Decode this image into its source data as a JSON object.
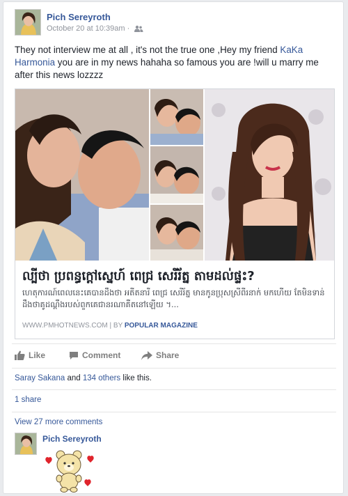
{
  "post": {
    "author": "Pich Sereyroth",
    "timestamp": "October 20 at 10:39am",
    "privacy_icon": "friends-icon",
    "text_before": "They not interview me at all , it's not the true one ,Hey my friend ",
    "mention": "KaKa Harmonia",
    "text_after": " you are in my news hahaha so famous you are !will u marry me after this news lozzzz"
  },
  "link_preview": {
    "title": "ល្បីថា ប្រពន្ធក្តៅស្នេហ៍ ពេជ្រ សេរីរ័ត្ន តាមដល់ផ្ទះ?",
    "description": "ហេតុការណ៍ពេលនេះគេបានដឹងថា អតីតនារី ពេជ្រ សេរីរ័ត្ន មានកូនប្រុសស្រីពីរនាក់ មកហើយ តែមិនទាន់ដឹងថាគូដណ្ដឹងរបស់ពួកគេជានរណាគឺតនៅឡើយ ។...",
    "domain": "WWW.PMHOTNEWS.COM",
    "separator": " | BY ",
    "brand": "POPULAR MAGAZINE"
  },
  "actions": {
    "like": "Like",
    "comment": "Comment",
    "share": "Share"
  },
  "likes": {
    "first_name": "Saray Sakana",
    "middle": " and ",
    "others": "134 others",
    "suffix": " like this."
  },
  "shares": "1 share",
  "more_comments": "View 27 more comments",
  "comment": {
    "author": "Pich Sereyroth",
    "sticker": "bear-hearts-sticker"
  },
  "colors": {
    "link": "#365899",
    "muted": "#90949c",
    "background": "#e9ebee"
  }
}
